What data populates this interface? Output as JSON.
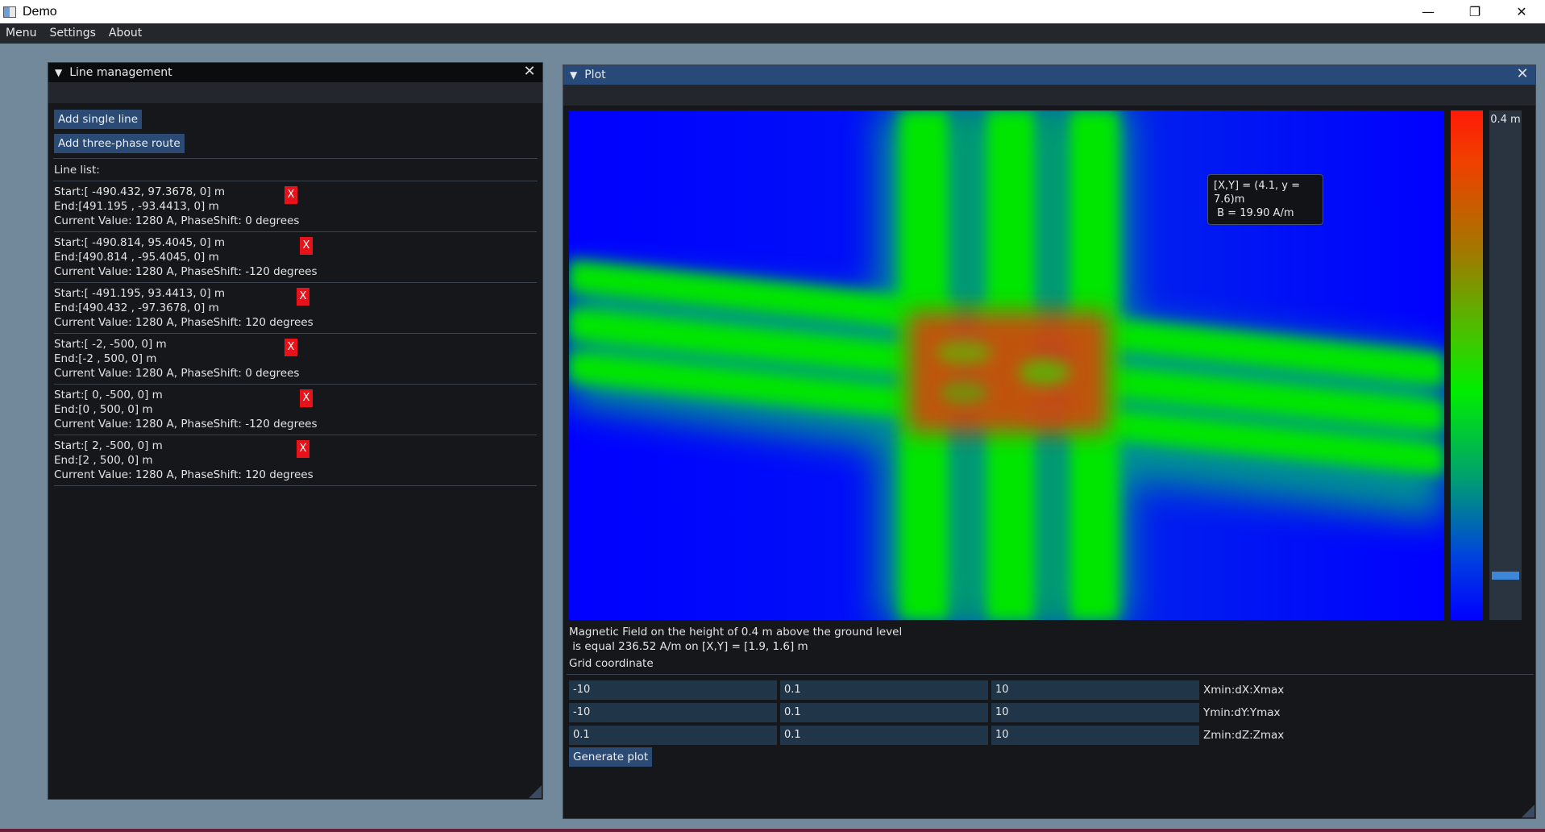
{
  "window": {
    "title": "Demo",
    "minimize": "—",
    "maximize": "❐",
    "close": "✕"
  },
  "menubar": [
    "Menu",
    "Settings",
    "About"
  ],
  "line_management": {
    "title": "Line management",
    "add_single": "Add single line",
    "add_three_phase": "Add three-phase route",
    "list_label": "Line list:",
    "delete_label": "X",
    "lines": [
      {
        "start": "Start:[ -490.432, 97.3678, 0] m",
        "end": "End:[491.195 , -93.4413, 0] m",
        "current": "Current Value: 1280 A, PhaseShift: 0 degrees"
      },
      {
        "start": "Start:[ -490.814, 95.4045, 0] m",
        "end": "End:[490.814 , -95.4045, 0] m",
        "current": "Current Value: 1280 A, PhaseShift: -120 degrees"
      },
      {
        "start": "Start:[ -491.195, 93.4413, 0] m",
        "end": "End:[490.432 , -97.3678, 0] m",
        "current": "Current Value: 1280 A, PhaseShift: 120 degrees"
      },
      {
        "start": "Start:[ -2, -500, 0] m",
        "end": "End:[-2 , 500, 0] m",
        "current": "Current Value: 1280 A, PhaseShift: 0 degrees"
      },
      {
        "start": "Start:[ 0, -500, 0] m",
        "end": "End:[0 , 500, 0] m",
        "current": "Current Value: 1280 A, PhaseShift: -120 degrees"
      },
      {
        "start": "Start:[ 2, -500, 0] m",
        "end": "End:[2 , 500, 0] m",
        "current": "Current Value: 1280 A, PhaseShift: 120 degrees"
      }
    ]
  },
  "plot": {
    "title": "Plot",
    "height_slider": {
      "label": "0.4 m",
      "value_fraction": 0.04
    },
    "tooltip": {
      "line1": "[X,Y] = (4.1, y = 7.6)m",
      "line2": " B = 19.90 A/m"
    },
    "info_line1": "Magnetic Field on the height of 0.4 m above the ground level",
    "info_line2": " is equal 236.52 A/m on [X,Y] = [1.9, 1.6] m",
    "grid_label": "Grid coordinate",
    "grid_rows": [
      {
        "min": "-10",
        "step": "0.1",
        "max": "10",
        "label": "Xmin:dX:Xmax"
      },
      {
        "min": "-10",
        "step": "0.1",
        "max": "10",
        "label": "Ymin:dY:Ymax"
      },
      {
        "min": "0.1",
        "step": "0.1",
        "max": "10",
        "label": "Zmin:dZ:Zmax"
      }
    ],
    "generate": "Generate plot",
    "colormap": {
      "high": "#ff1a08",
      "mid": "#00ee00",
      "low": "#0000ff"
    }
  }
}
